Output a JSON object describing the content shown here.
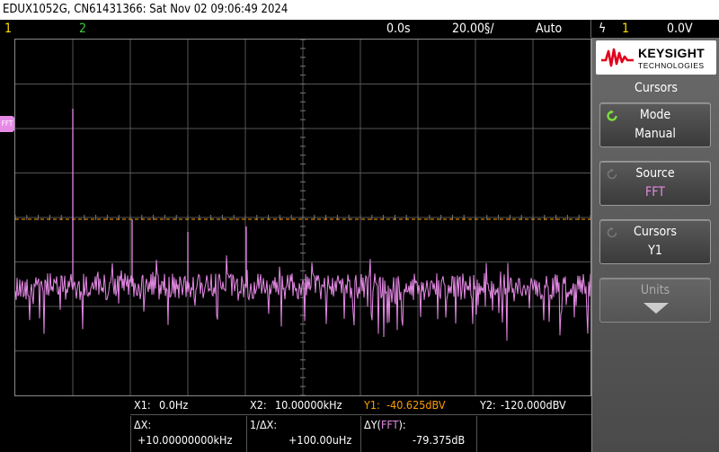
{
  "header": {
    "title": "EDUX1052G, CN61431366: Sat Nov 02 09:06:49 2024"
  },
  "status": {
    "ch1": "1",
    "ch2": "2",
    "time_delay": "0.0s",
    "time_scale": "20.00§/",
    "trigger_mode": "Auto",
    "trigger_symbol": "ϟ",
    "trigger_channel": "1",
    "trigger_level": "0.0V"
  },
  "waveform": {
    "label": "FFT",
    "colors": {
      "fft": "#e68ae6",
      "cursor": "#ff9c00",
      "grid": "#555555"
    }
  },
  "readout": {
    "x1_label": "X1:",
    "x1_value": "0.0Hz",
    "x2_label": "X2:",
    "x2_value": "10.00000kHz",
    "y1_label": "Y1:",
    "y1_value": "-40.625dBV",
    "y2_label": "Y2:",
    "y2_value": "-120.000dBV",
    "dx_label": "ΔX:",
    "dx_value": "+10.00000000kHz",
    "inv_dx_label": "1/ΔX:",
    "inv_dx_value": "+100.00uHz",
    "dy_label": "ΔY(",
    "dy_source": "FFT",
    "dy_close": "):",
    "dy_value": "-79.375dB"
  },
  "panel": {
    "brand": "KEYSIGHT",
    "brand_sub": "TECHNOLOGIES",
    "title": "Cursors",
    "softkeys": [
      {
        "top": "Mode",
        "bottom": "Manual"
      },
      {
        "top": "Source",
        "bottom": "FFT"
      },
      {
        "top": "Cursors",
        "bottom": "Y1"
      },
      {
        "top": "Units",
        "bottom": ""
      }
    ]
  }
}
